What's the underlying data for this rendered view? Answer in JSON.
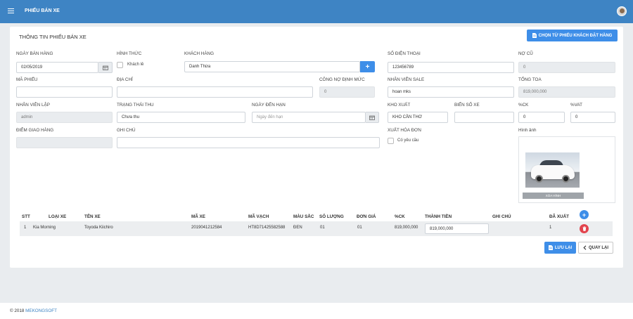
{
  "app": {
    "title": "PHIẾU BÁN XE"
  },
  "form": {
    "title": "THÔNG TIN PHIẾU BÁN XE",
    "choose_order_label": "CHỌN TỪ PHIẾU KHÁCH ĐẶT HÀNG",
    "sale_date": {
      "label": "NGÀY BÁN HÀNG",
      "value": "02/05/2019"
    },
    "form_type": {
      "label": "HÌNH THỨC",
      "option": "Khách lẻ"
    },
    "customer": {
      "label": "KHÁCH HÀNG",
      "value": "Danh Thừa"
    },
    "phone": {
      "label": "SỐ ĐIỆN THOẠI",
      "value": "123456789"
    },
    "old_debt": {
      "label": "NỢ CŨ",
      "value": "0"
    },
    "code": {
      "label": "MÃ PHIẾU",
      "value": ""
    },
    "address": {
      "label": "ĐỊA CHỈ",
      "value": ""
    },
    "debt_norm": {
      "label": "CÔNG NỢ ĐỊNH MỨC",
      "value": "0"
    },
    "sales_staff": {
      "label": "NHÂN VIÊN SALE",
      "value": "hoan mks"
    },
    "total": {
      "label": "TỔNG TOA",
      "value": "819,000,000"
    },
    "creator": {
      "label": "NHÂN VIÊN LẬP",
      "value": "admin"
    },
    "pay_status": {
      "label": "TRẠNG THÁI THU",
      "value": "Chưa thu"
    },
    "due_date": {
      "label": "NGÀY ĐẾN HẠN",
      "placeholder": "Ngày đến hạn"
    },
    "warehouse": {
      "label": "KHO XUẤT",
      "value": "KHO CẦN THƠ"
    },
    "plate": {
      "label": "BIỂN SỐ XE",
      "value": ""
    },
    "ck": {
      "label": "%CK",
      "value": "0"
    },
    "vat": {
      "label": "%VAT",
      "value": "0"
    },
    "delivery_point": {
      "label": "ĐIỂM GIAO HÀNG",
      "value": ""
    },
    "note": {
      "label": "GHI CHÚ",
      "value": ""
    },
    "invoice": {
      "label": "XUẤT HÓA ĐƠN",
      "option": "Có yêu cầu"
    },
    "image": {
      "label": "Hình ảnh",
      "delete_label": "XÓA HÌNH"
    }
  },
  "table": {
    "headers": [
      "STT",
      "LOẠI XE",
      "TÊN XE",
      "MÃ XE",
      "MÃ VẠCH",
      "MÀU SẮC",
      "SỐ LƯỢNG",
      "ĐƠN GIÁ",
      "%CK",
      "THÀNH TIỀN",
      "GHI CHÚ",
      "ĐÃ XUẤT"
    ],
    "rows": [
      {
        "stt": "1",
        "type": "Kia Morning",
        "name": "Toyoda Kiichiro",
        "code": "2019041212584",
        "barcode": "HT8D71425582588",
        "color": "ĐEN",
        "qty": "01",
        "unit_price": "01",
        "ck": "819,000,000",
        "amount": "819,000,000",
        "note": "",
        "exported": "1"
      }
    ]
  },
  "actions": {
    "save_label": "LƯU LẠI",
    "back_label": "QUAY LẠI"
  },
  "footer": {
    "copyright": "© 2018 ",
    "brand": "MEKONGSOFT"
  },
  "colors": {
    "header": "#3e84c4",
    "primary": "#3e8ee8",
    "danger": "#e2444d"
  }
}
